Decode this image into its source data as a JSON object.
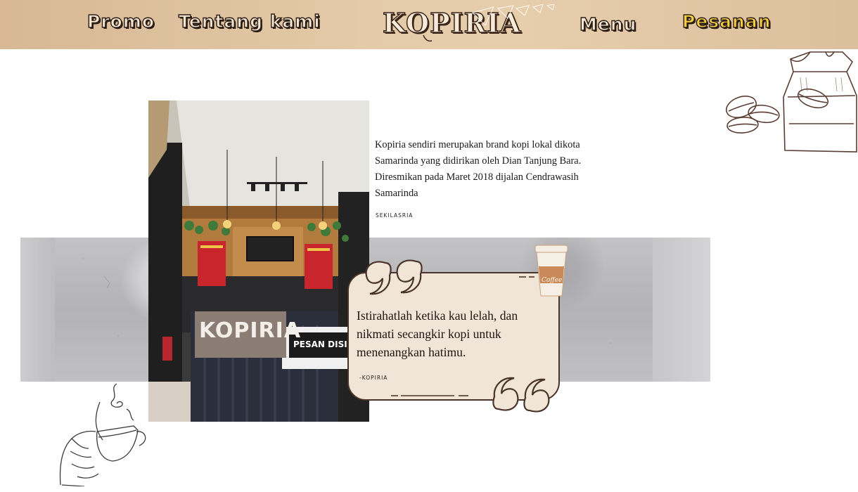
{
  "nav": {
    "promo": "Promo",
    "tentang": "Tentang kami",
    "menu": "Menu",
    "pesanan": "Pesanan"
  },
  "brand": {
    "logo_text": "KOPIRIA",
    "accent_color": "#f4cf3f",
    "header_color": "#e0c5a3"
  },
  "about": {
    "text": "Kopiria sendiri merupakan brand kopi lokal dikota Samarinda yang didirikan oleh Dian Tanjung Bara. Diresmikan pada Maret 2018 dijalan Cendrawasih Samarinda",
    "caption": "SEKILASRIA"
  },
  "photo": {
    "sign_text": "KOPIRIA",
    "counter_sign": "PESAN DISINI"
  },
  "quote": {
    "text": "Istirahatlah ketika kau lelah, dan nikmati secangkir kopi untuk menenangkan hatimu.",
    "author": "-KOPIRIA",
    "cup_label": "Coffee"
  }
}
